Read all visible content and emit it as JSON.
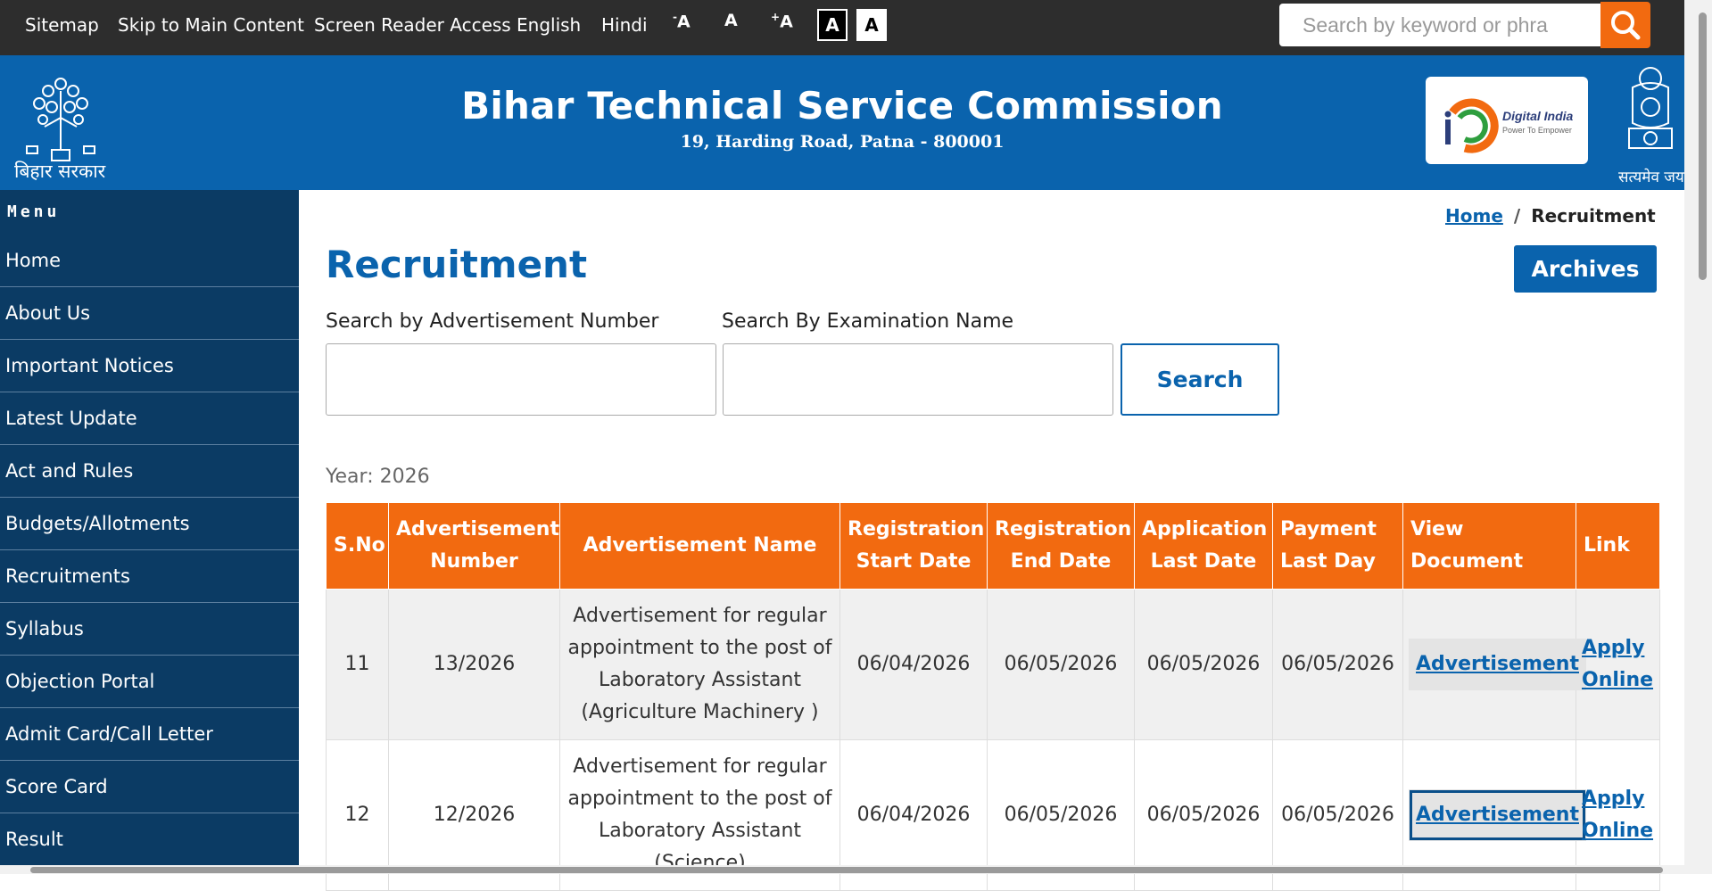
{
  "topbar": {
    "links": [
      "Sitemap",
      "Skip to Main Content",
      "Screen Reader Access",
      "English",
      "Hindi"
    ],
    "font_decrease": "A",
    "font_normal": "A",
    "font_increase": "A",
    "contrast_dark": "A",
    "contrast_light": "A",
    "search_placeholder": "Search by keyword or phra"
  },
  "header": {
    "title": "Bihar Technical Service Commission",
    "address": "19, Harding Road, Patna - 800001",
    "state_label": "बिहार सरकार",
    "digital_india": "Digital India",
    "digital_india_tag": "Power To Empower",
    "emblem_motto": "सत्यमेव जयते"
  },
  "sidebar": {
    "heading": "Menu",
    "items": [
      "Home",
      "About Us",
      "Important Notices",
      "Latest Update",
      "Act and Rules",
      "Budgets/Allotments",
      "Recruitments",
      "Syllabus",
      "Objection Portal",
      "Admit Card/Call Letter",
      "Score Card",
      "Result"
    ]
  },
  "breadcrumb": {
    "home": "Home",
    "separator": "/",
    "current": "Recruitment"
  },
  "main": {
    "title": "Recruitment",
    "archives_label": "Archives",
    "adv_number_label": "Search by Advertisement Number",
    "exam_name_label": "Search By Examination Name",
    "search_label": "Search",
    "year_label": "Year: 2026"
  },
  "table": {
    "headers": [
      "S.No",
      "Advertisement Number",
      "Advertisement Name",
      "Registration Start Date",
      "Registration End Date",
      "Application Last Date",
      "Payment Last Day",
      "View Document",
      "Link"
    ],
    "rows": [
      {
        "sno": "11",
        "adv_no": "13/2026",
        "name": "Advertisement for regular appointment to the post of Laboratory Assistant (Agriculture Machinery )",
        "reg_start": "06/04/2026",
        "reg_end": "06/05/2026",
        "app_last": "06/05/2026",
        "pay_last": "06/05/2026",
        "doc": "Advertisement",
        "link": "Apply Online"
      },
      {
        "sno": "12",
        "adv_no": "12/2026",
        "name": "Advertisement for regular appointment to the post of Laboratory Assistant (Science)",
        "reg_start": "06/04/2026",
        "reg_end": "06/05/2026",
        "app_last": "06/05/2026",
        "pay_last": "06/05/2026",
        "doc": "Advertisement",
        "link": "Apply Online"
      }
    ]
  },
  "colors": {
    "header_blue": "#0a63ad",
    "sidebar_navy": "#0b3b64",
    "accent_orange": "#f26a10",
    "topbar": "#2d2d2d"
  }
}
